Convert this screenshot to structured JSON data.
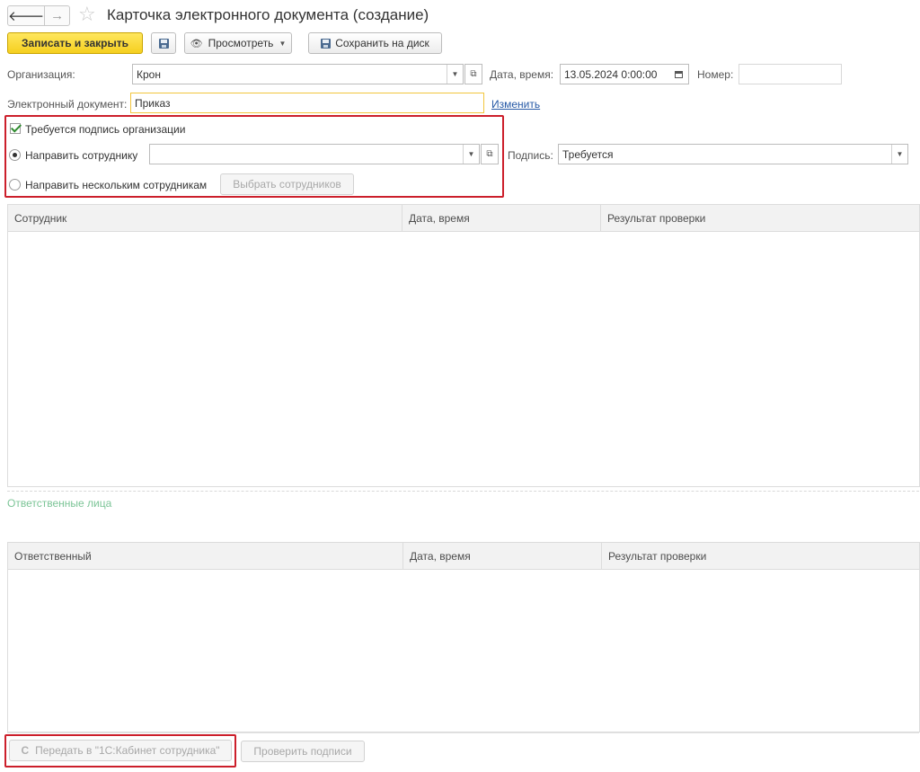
{
  "header": {
    "back_glyph": "🡐",
    "forward_glyph": "→",
    "favorite_glyph": "☆",
    "title": "Карточка электронного документа (создание)"
  },
  "toolbar": {
    "save_close_label": "Записать и закрыть",
    "view_label": "Просмотреть",
    "save_disk_label": "Сохранить на диск"
  },
  "form": {
    "org_label": "Организация:",
    "org_value": "Крон",
    "date_label": "Дата, время:",
    "date_value": "13.05.2024  0:00:00",
    "number_label": "Номер:",
    "number_value": "",
    "edoc_label": "Электронный документ:",
    "edoc_value": "Приказ",
    "change_link": "Изменить",
    "requires_org_sign_label": "Требуется подпись организации",
    "requires_org_sign_checked": true,
    "send_employee_label": "Направить сотруднику",
    "send_employee_value": "",
    "sign_label": "Подпись:",
    "sign_value": "Требуется",
    "send_multiple_label": "Направить нескольким сотрудникам",
    "select_employees_label": "Выбрать сотрудников",
    "selected_option": "send_employee"
  },
  "employees_table": {
    "columns": [
      "Сотрудник",
      "Дата, время",
      "Результат проверки"
    ],
    "rows": []
  },
  "responsible_section": {
    "title": "Ответственные лица"
  },
  "responsible_table": {
    "columns": [
      "Ответственный",
      "Дата, время",
      "Результат проверки"
    ],
    "rows": []
  },
  "footer": {
    "send_cabinet_label": "Передать в \"1С:Кабинет сотрудника\"",
    "check_signatures_label": "Проверить подписи"
  },
  "colors": {
    "primary_button": "#f5cf1f",
    "highlight_box": "#cc1f2b",
    "section_title": "#7bc496",
    "link": "#2659a6"
  },
  "icons": [
    "back-arrow-icon",
    "forward-arrow-icon",
    "favorite-star-icon",
    "save-disk-icon",
    "eye-icon",
    "dropdown-arrow-icon",
    "open-form-icon",
    "calendar-icon",
    "checkbox-checked-icon",
    "radio-icon",
    "1c-logo-icon"
  ]
}
